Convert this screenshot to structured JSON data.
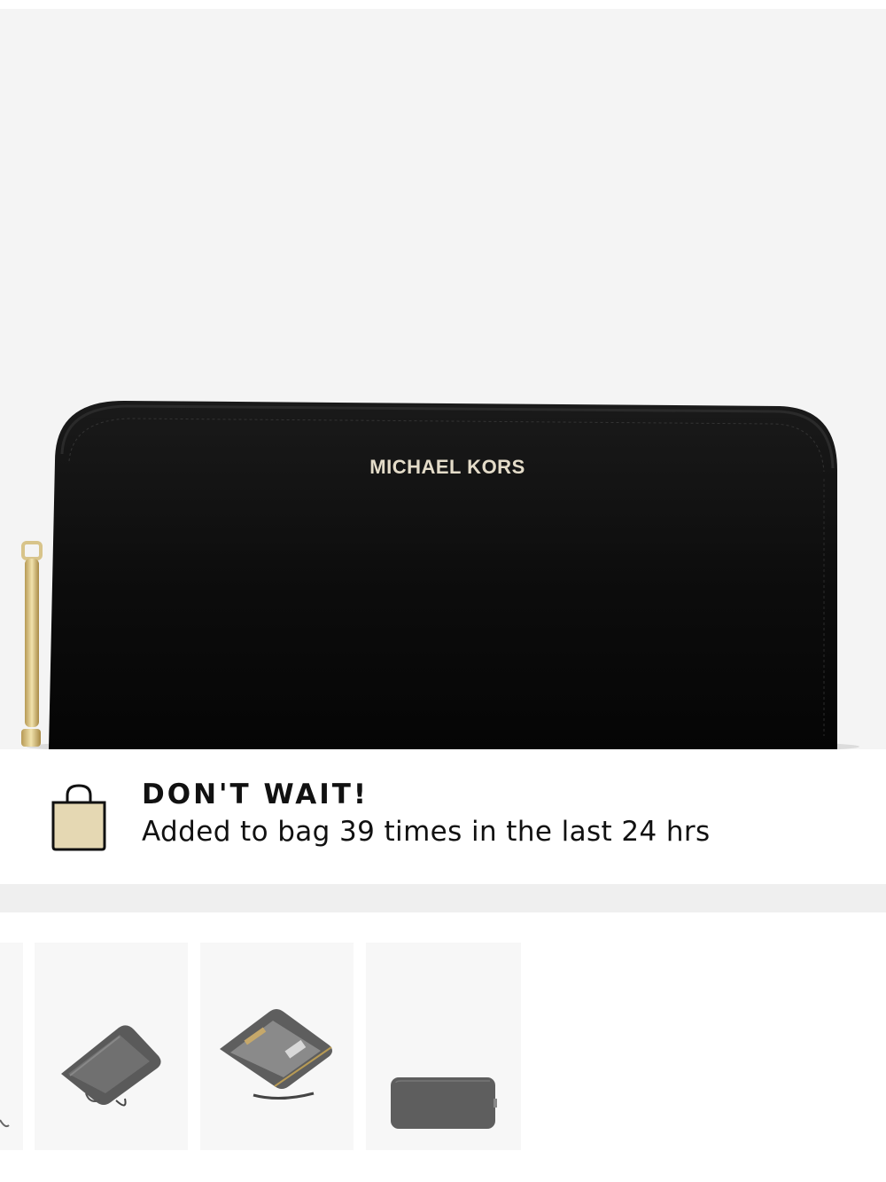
{
  "product": {
    "brand_logo": "MICHAEL KORS",
    "color": "#0c0c0c",
    "hardware_color": "#d8c48a"
  },
  "promo_banner": {
    "heading": "DON'T WAIT!",
    "message": "Added to bag 39 times in the last 24 hrs",
    "icon": "shopping-bag-icon",
    "icon_fill": "#e5d8b3"
  },
  "thumbnails": [
    {
      "name": "thumbnail-partial"
    },
    {
      "name": "thumbnail-open-wallet"
    },
    {
      "name": "thumbnail-open-wallet-interior"
    },
    {
      "name": "thumbnail-wallet-back"
    }
  ]
}
